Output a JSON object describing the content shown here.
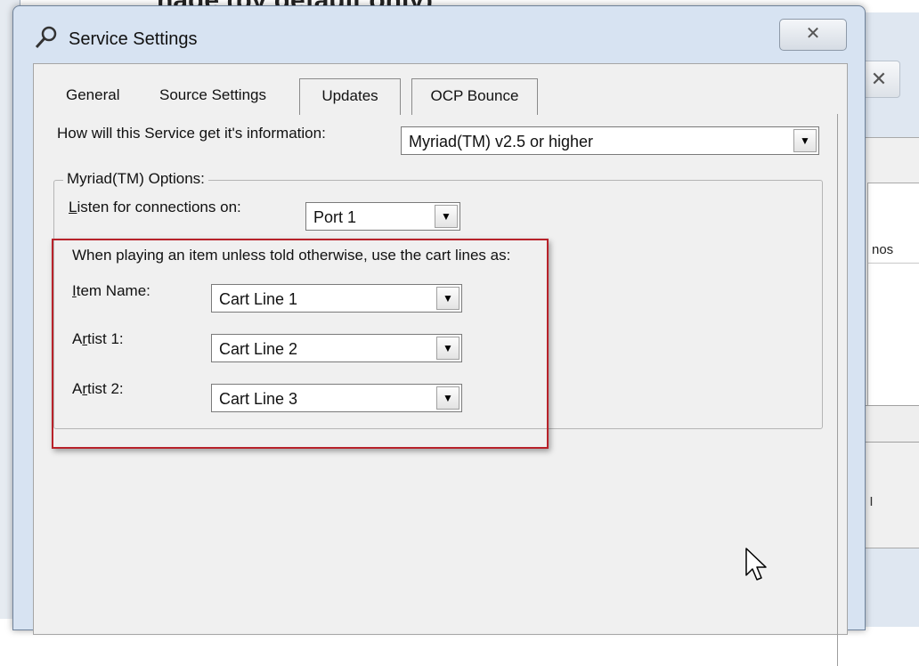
{
  "page_header": {
    "text": "nage (by default only)"
  },
  "background_window": {
    "close_glyph": "✕",
    "column_header": "nos",
    "text_fragment": "I I"
  },
  "dialog": {
    "title": "Service Settings",
    "close_glyph": "✕",
    "tabs": [
      {
        "label": "General"
      },
      {
        "label": "Source Settings"
      },
      {
        "label": "Updates"
      },
      {
        "label": "OCP Bounce"
      }
    ],
    "source": {
      "question_label": "How will this Service get it's information:",
      "source_select": "Myriad(TM) v2.5 or higher",
      "group_title": "Myriad(TM) Options:",
      "listen_label_pre": "",
      "listen_label_key": "L",
      "listen_label_post": "isten for connections on:",
      "listen_select": "Port 1",
      "cart_intro": "When playing an item unless told otherwise, use the cart lines as:",
      "item_name": {
        "key": "I",
        "rest": "tem Name:",
        "value": "Cart Line 1"
      },
      "artist1": {
        "pre": "A",
        "key": "r",
        "rest": "tist 1:",
        "value": "Cart Line 2"
      },
      "artist2": {
        "pre": "A",
        "key": "r",
        "rest": "tist 2:",
        "value": "Cart Line 3"
      }
    },
    "icons": {
      "title_icon": "wrench-icon",
      "dropdown_arrow": "▼"
    }
  }
}
